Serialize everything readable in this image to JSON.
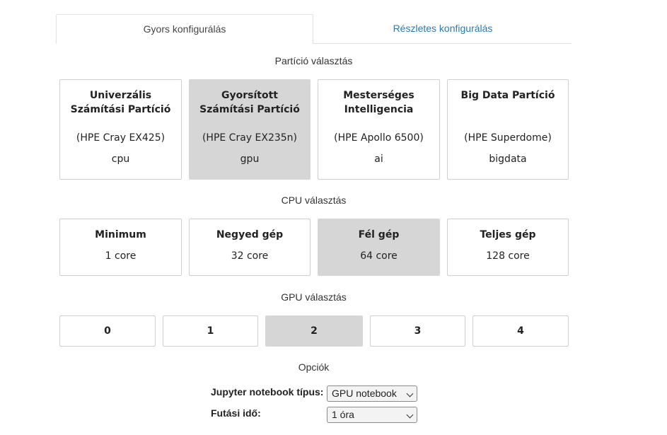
{
  "tabs": [
    {
      "label": "Gyors konfigurálás"
    },
    {
      "label": "Részletes konfigurálás"
    }
  ],
  "partition": {
    "title": "Partíció választás",
    "items": [
      {
        "title": "Univerzális Számítási Partíció",
        "model": "(HPE Cray EX425)",
        "code": "cpu",
        "selected": false
      },
      {
        "title": "Gyorsított Számítási Partíció",
        "model": "(HPE Cray EX235n)",
        "code": "gpu",
        "selected": true
      },
      {
        "title": "Mesterséges Intelligencia",
        "model": "(HPE Apollo 6500)",
        "code": "ai",
        "selected": false
      },
      {
        "title": "Big Data Partíció",
        "model": "(HPE Superdome)",
        "code": "bigdata",
        "selected": false
      }
    ]
  },
  "cpu": {
    "title": "CPU választás",
    "items": [
      {
        "title": "Minimum",
        "cores": "1 core",
        "selected": false
      },
      {
        "title": "Negyed gép",
        "cores": "32 core",
        "selected": false
      },
      {
        "title": "Fél gép",
        "cores": "64 core",
        "selected": true
      },
      {
        "title": "Teljes gép",
        "cores": "128 core",
        "selected": false
      }
    ]
  },
  "gpu": {
    "title": "GPU választás",
    "items": [
      {
        "label": "0",
        "selected": false
      },
      {
        "label": "1",
        "selected": false
      },
      {
        "label": "2",
        "selected": true
      },
      {
        "label": "3",
        "selected": false
      },
      {
        "label": "4",
        "selected": false
      }
    ]
  },
  "options": {
    "title": "Opciók",
    "notebook_label": "Jupyter notebook típus:",
    "notebook_value": "GPU notebook",
    "runtime_label": "Futási idő:",
    "runtime_value": "1 óra"
  }
}
